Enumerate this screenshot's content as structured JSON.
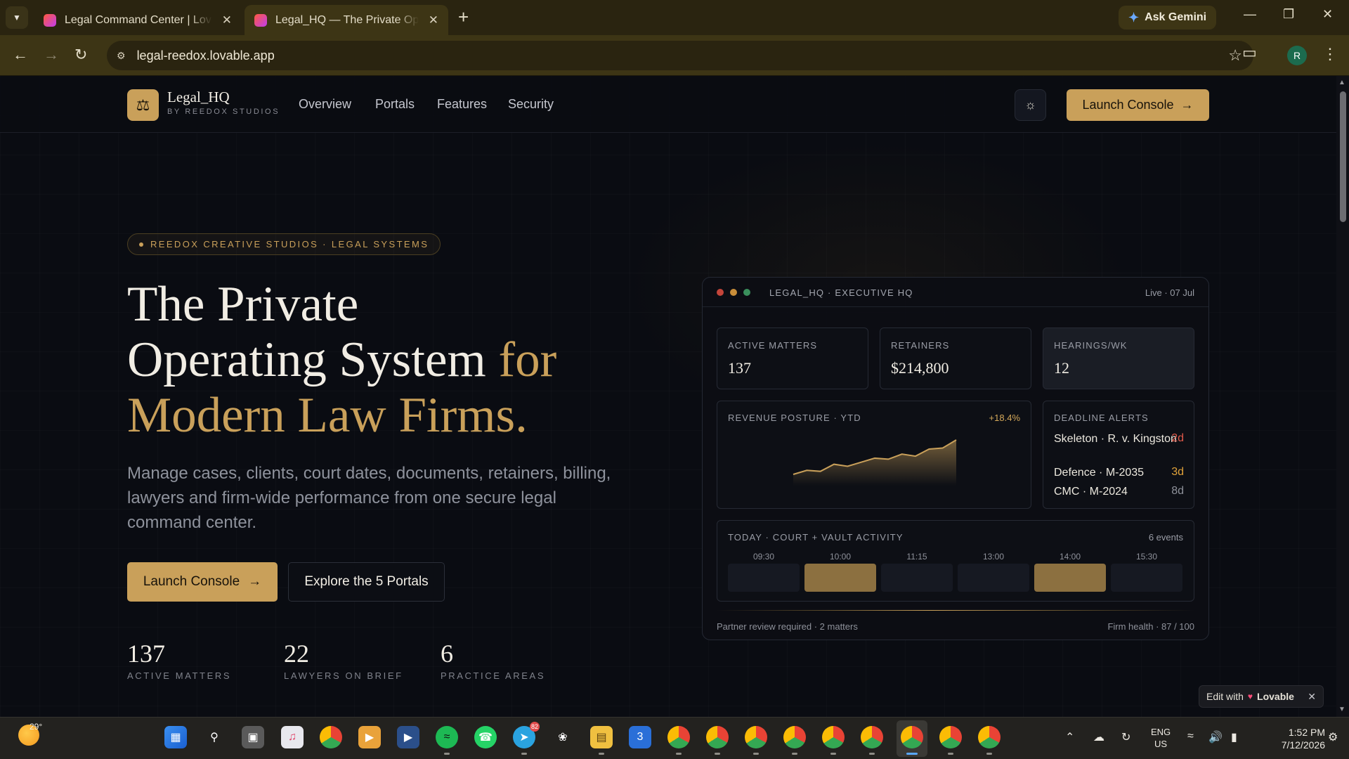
{
  "browser": {
    "tabs": [
      {
        "title": "Legal Command Center | Lovable",
        "active": false
      },
      {
        "title": "Legal_HQ — The Private Operating System",
        "active": true
      }
    ],
    "ask_gemini": "Ask Gemini",
    "url": "legal-reedox.lovable.app",
    "profile_initial": "R"
  },
  "site": {
    "brand_name": "Legal_HQ",
    "brand_sub": "BY REEDOX STUDIOS",
    "nav": [
      "Overview",
      "Portals",
      "Features",
      "Security"
    ],
    "launch_label": "Launch Console"
  },
  "hero": {
    "eyebrow": "REEDOX CREATIVE STUDIOS · LEGAL SYSTEMS",
    "title_line1": "The Private",
    "title_line2_a": "Operating System ",
    "title_line2_b": "for",
    "title_line3": "Modern Law Firms.",
    "description": "Manage cases, clients, court dates, documents, retainers, billing, lawyers and firm-wide performance from one secure legal command center.",
    "primary_cta": "Launch Console",
    "secondary_cta": "Explore the 5 Portals",
    "stats": [
      {
        "value": "137",
        "label": "ACTIVE MATTERS"
      },
      {
        "value": "22",
        "label": "LAWYERS ON BRIEF"
      },
      {
        "value": "6",
        "label": "PRACTICE AREAS"
      }
    ]
  },
  "dashboard": {
    "title": "LEGAL_HQ · EXECUTIVE HQ",
    "live": "Live · 07 Jul",
    "kpis": [
      {
        "label": "ACTIVE MATTERS",
        "value": "137"
      },
      {
        "label": "RETAINERS",
        "value": "$214,800"
      },
      {
        "label": "HEARINGS/WK",
        "value": "12"
      }
    ],
    "revenue": {
      "label": "REVENUE POSTURE · YTD",
      "change": "+18.4%",
      "trend": [
        10,
        14,
        13,
        20,
        18,
        22,
        26,
        25,
        30,
        28,
        35,
        36,
        44
      ]
    },
    "alerts": {
      "label": "DEADLINE ALERTS",
      "items": [
        {
          "name": "Skeleton · R. v. Kingston",
          "due": "2d",
          "color": "#e0594a"
        },
        {
          "name": "Defence · M-2035",
          "due": "3d",
          "color": "#e0a23a"
        },
        {
          "name": "CMC · M-2024",
          "due": "8d",
          "color": "#8e919a"
        }
      ]
    },
    "activity": {
      "label": "TODAY · COURT + VAULT ACTIVITY",
      "count": "6 events",
      "slots": [
        {
          "time": "09:30",
          "active": false
        },
        {
          "time": "10:00",
          "active": true
        },
        {
          "time": "11:15",
          "active": false
        },
        {
          "time": "13:00",
          "active": false
        },
        {
          "time": "14:00",
          "active": true
        },
        {
          "time": "15:30",
          "active": false
        }
      ]
    },
    "footer_left": "Partner review required · 2 matters",
    "footer_right": "Firm health · 87 / 100"
  },
  "lovable": {
    "prefix": "Edit with",
    "brand": "Lovable"
  },
  "taskbar": {
    "temp": "29°",
    "lang_top": "ENG",
    "lang_bottom": "US",
    "time": "1:52 PM",
    "date": "7/12/2026",
    "telegram_badge": "82"
  },
  "colors": {
    "accent": "#c9a05a",
    "background": "#0a0c12"
  }
}
